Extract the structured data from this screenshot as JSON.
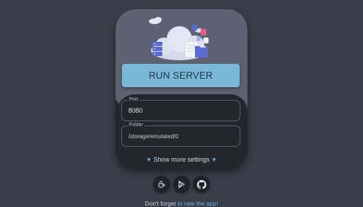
{
  "main": {
    "run_button_label": "RUN SERVER",
    "port": {
      "label": "Port",
      "value": "8080"
    },
    "folder": {
      "label": "Folder",
      "value": "/storage/emulated/0"
    },
    "more_settings": {
      "label": "Show more settings",
      "arrow": "▼"
    }
  },
  "footer": {
    "prefix": "Don't forget ",
    "link_label": "to rate the app!"
  },
  "icons": [
    "cloud-server-illustration",
    "coffee-icon",
    "play-store-icon",
    "github-icon"
  ],
  "colors": {
    "accent": "#79b8d6",
    "link": "#6fb4e6",
    "background": "#3a3e48",
    "card": "#23262d"
  }
}
